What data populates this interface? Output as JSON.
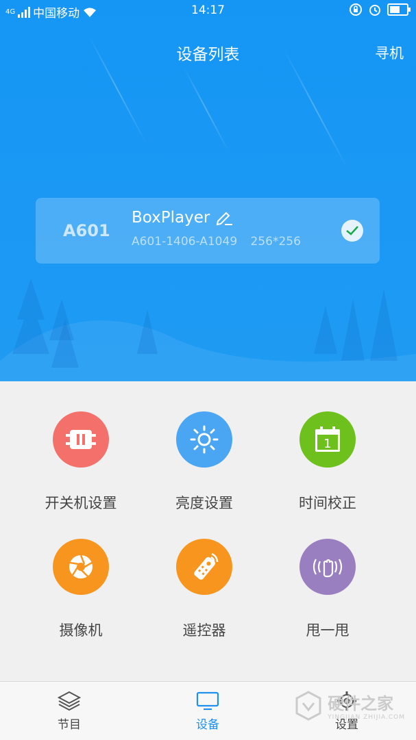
{
  "status_bar": {
    "network": "4G",
    "carrier": "中国移动",
    "time": "14:17"
  },
  "header": {
    "title": "设备列表",
    "action": "寻机"
  },
  "device": {
    "model": "A601",
    "name": "BoxPlayer",
    "id": "A601-1406-A1049",
    "resolution": "256*256",
    "selected": true
  },
  "functions": [
    {
      "label": "开关机设置",
      "icon": "power-plug-icon",
      "color": "#f3716a"
    },
    {
      "label": "亮度设置",
      "icon": "sun-brightness-icon",
      "color": "#4aa6f2"
    },
    {
      "label": "时间校正",
      "icon": "calendar-icon",
      "color": "#6ec11d"
    },
    {
      "label": "摄像机",
      "icon": "camera-shutter-icon",
      "color": "#f8951e"
    },
    {
      "label": "遥控器",
      "icon": "remote-control-icon",
      "color": "#f8951e"
    },
    {
      "label": "甩一甩",
      "icon": "shake-hand-icon",
      "color": "#9a7fc0"
    }
  ],
  "tabs": [
    {
      "label": "节目",
      "icon": "layers-icon",
      "active": false
    },
    {
      "label": "设备",
      "icon": "monitor-icon",
      "active": true
    },
    {
      "label": "设置",
      "icon": "gear-icon",
      "active": false
    }
  ],
  "watermark": {
    "title": "硬件之家",
    "subtitle": "YINGJIAN ZHIJIA.COM"
  },
  "colors": {
    "brand_blue": "#1596f5",
    "active_tab": "#1e90f0"
  }
}
